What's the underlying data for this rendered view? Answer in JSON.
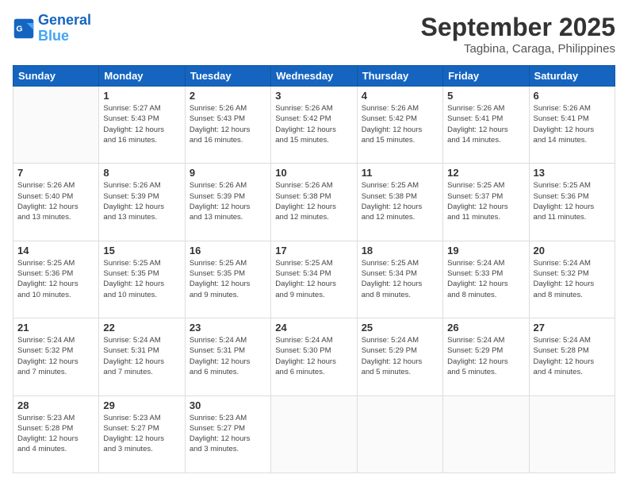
{
  "logo": {
    "line1": "General",
    "line2": "Blue"
  },
  "title": "September 2025",
  "subtitle": "Tagbina, Caraga, Philippines",
  "weekdays": [
    "Sunday",
    "Monday",
    "Tuesday",
    "Wednesday",
    "Thursday",
    "Friday",
    "Saturday"
  ],
  "weeks": [
    [
      {
        "day": "",
        "info": ""
      },
      {
        "day": "1",
        "info": "Sunrise: 5:27 AM\nSunset: 5:43 PM\nDaylight: 12 hours\nand 16 minutes."
      },
      {
        "day": "2",
        "info": "Sunrise: 5:26 AM\nSunset: 5:43 PM\nDaylight: 12 hours\nand 16 minutes."
      },
      {
        "day": "3",
        "info": "Sunrise: 5:26 AM\nSunset: 5:42 PM\nDaylight: 12 hours\nand 15 minutes."
      },
      {
        "day": "4",
        "info": "Sunrise: 5:26 AM\nSunset: 5:42 PM\nDaylight: 12 hours\nand 15 minutes."
      },
      {
        "day": "5",
        "info": "Sunrise: 5:26 AM\nSunset: 5:41 PM\nDaylight: 12 hours\nand 14 minutes."
      },
      {
        "day": "6",
        "info": "Sunrise: 5:26 AM\nSunset: 5:41 PM\nDaylight: 12 hours\nand 14 minutes."
      }
    ],
    [
      {
        "day": "7",
        "info": "Sunrise: 5:26 AM\nSunset: 5:40 PM\nDaylight: 12 hours\nand 13 minutes."
      },
      {
        "day": "8",
        "info": "Sunrise: 5:26 AM\nSunset: 5:39 PM\nDaylight: 12 hours\nand 13 minutes."
      },
      {
        "day": "9",
        "info": "Sunrise: 5:26 AM\nSunset: 5:39 PM\nDaylight: 12 hours\nand 13 minutes."
      },
      {
        "day": "10",
        "info": "Sunrise: 5:26 AM\nSunset: 5:38 PM\nDaylight: 12 hours\nand 12 minutes."
      },
      {
        "day": "11",
        "info": "Sunrise: 5:25 AM\nSunset: 5:38 PM\nDaylight: 12 hours\nand 12 minutes."
      },
      {
        "day": "12",
        "info": "Sunrise: 5:25 AM\nSunset: 5:37 PM\nDaylight: 12 hours\nand 11 minutes."
      },
      {
        "day": "13",
        "info": "Sunrise: 5:25 AM\nSunset: 5:36 PM\nDaylight: 12 hours\nand 11 minutes."
      }
    ],
    [
      {
        "day": "14",
        "info": "Sunrise: 5:25 AM\nSunset: 5:36 PM\nDaylight: 12 hours\nand 10 minutes."
      },
      {
        "day": "15",
        "info": "Sunrise: 5:25 AM\nSunset: 5:35 PM\nDaylight: 12 hours\nand 10 minutes."
      },
      {
        "day": "16",
        "info": "Sunrise: 5:25 AM\nSunset: 5:35 PM\nDaylight: 12 hours\nand 9 minutes."
      },
      {
        "day": "17",
        "info": "Sunrise: 5:25 AM\nSunset: 5:34 PM\nDaylight: 12 hours\nand 9 minutes."
      },
      {
        "day": "18",
        "info": "Sunrise: 5:25 AM\nSunset: 5:34 PM\nDaylight: 12 hours\nand 8 minutes."
      },
      {
        "day": "19",
        "info": "Sunrise: 5:24 AM\nSunset: 5:33 PM\nDaylight: 12 hours\nand 8 minutes."
      },
      {
        "day": "20",
        "info": "Sunrise: 5:24 AM\nSunset: 5:32 PM\nDaylight: 12 hours\nand 8 minutes."
      }
    ],
    [
      {
        "day": "21",
        "info": "Sunrise: 5:24 AM\nSunset: 5:32 PM\nDaylight: 12 hours\nand 7 minutes."
      },
      {
        "day": "22",
        "info": "Sunrise: 5:24 AM\nSunset: 5:31 PM\nDaylight: 12 hours\nand 7 minutes."
      },
      {
        "day": "23",
        "info": "Sunrise: 5:24 AM\nSunset: 5:31 PM\nDaylight: 12 hours\nand 6 minutes."
      },
      {
        "day": "24",
        "info": "Sunrise: 5:24 AM\nSunset: 5:30 PM\nDaylight: 12 hours\nand 6 minutes."
      },
      {
        "day": "25",
        "info": "Sunrise: 5:24 AM\nSunset: 5:29 PM\nDaylight: 12 hours\nand 5 minutes."
      },
      {
        "day": "26",
        "info": "Sunrise: 5:24 AM\nSunset: 5:29 PM\nDaylight: 12 hours\nand 5 minutes."
      },
      {
        "day": "27",
        "info": "Sunrise: 5:24 AM\nSunset: 5:28 PM\nDaylight: 12 hours\nand 4 minutes."
      }
    ],
    [
      {
        "day": "28",
        "info": "Sunrise: 5:23 AM\nSunset: 5:28 PM\nDaylight: 12 hours\nand 4 minutes."
      },
      {
        "day": "29",
        "info": "Sunrise: 5:23 AM\nSunset: 5:27 PM\nDaylight: 12 hours\nand 3 minutes."
      },
      {
        "day": "30",
        "info": "Sunrise: 5:23 AM\nSunset: 5:27 PM\nDaylight: 12 hours\nand 3 minutes."
      },
      {
        "day": "",
        "info": ""
      },
      {
        "day": "",
        "info": ""
      },
      {
        "day": "",
        "info": ""
      },
      {
        "day": "",
        "info": ""
      }
    ]
  ]
}
